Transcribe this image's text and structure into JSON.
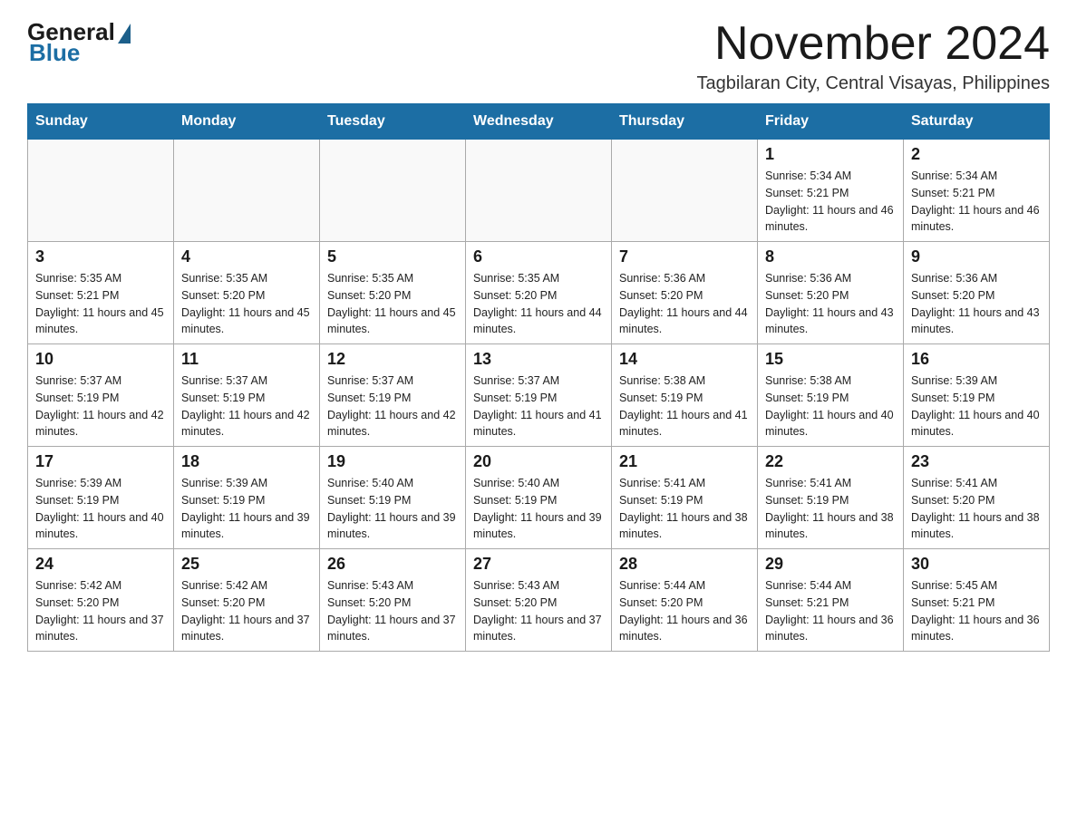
{
  "logo": {
    "general": "General",
    "blue": "Blue"
  },
  "title": "November 2024",
  "location": "Tagbilaran City, Central Visayas, Philippines",
  "days_of_week": [
    "Sunday",
    "Monday",
    "Tuesday",
    "Wednesday",
    "Thursday",
    "Friday",
    "Saturday"
  ],
  "weeks": [
    [
      {
        "day": "",
        "info": ""
      },
      {
        "day": "",
        "info": ""
      },
      {
        "day": "",
        "info": ""
      },
      {
        "day": "",
        "info": ""
      },
      {
        "day": "",
        "info": ""
      },
      {
        "day": "1",
        "info": "Sunrise: 5:34 AM\nSunset: 5:21 PM\nDaylight: 11 hours and 46 minutes."
      },
      {
        "day": "2",
        "info": "Sunrise: 5:34 AM\nSunset: 5:21 PM\nDaylight: 11 hours and 46 minutes."
      }
    ],
    [
      {
        "day": "3",
        "info": "Sunrise: 5:35 AM\nSunset: 5:21 PM\nDaylight: 11 hours and 45 minutes."
      },
      {
        "day": "4",
        "info": "Sunrise: 5:35 AM\nSunset: 5:20 PM\nDaylight: 11 hours and 45 minutes."
      },
      {
        "day": "5",
        "info": "Sunrise: 5:35 AM\nSunset: 5:20 PM\nDaylight: 11 hours and 45 minutes."
      },
      {
        "day": "6",
        "info": "Sunrise: 5:35 AM\nSunset: 5:20 PM\nDaylight: 11 hours and 44 minutes."
      },
      {
        "day": "7",
        "info": "Sunrise: 5:36 AM\nSunset: 5:20 PM\nDaylight: 11 hours and 44 minutes."
      },
      {
        "day": "8",
        "info": "Sunrise: 5:36 AM\nSunset: 5:20 PM\nDaylight: 11 hours and 43 minutes."
      },
      {
        "day": "9",
        "info": "Sunrise: 5:36 AM\nSunset: 5:20 PM\nDaylight: 11 hours and 43 minutes."
      }
    ],
    [
      {
        "day": "10",
        "info": "Sunrise: 5:37 AM\nSunset: 5:19 PM\nDaylight: 11 hours and 42 minutes."
      },
      {
        "day": "11",
        "info": "Sunrise: 5:37 AM\nSunset: 5:19 PM\nDaylight: 11 hours and 42 minutes."
      },
      {
        "day": "12",
        "info": "Sunrise: 5:37 AM\nSunset: 5:19 PM\nDaylight: 11 hours and 42 minutes."
      },
      {
        "day": "13",
        "info": "Sunrise: 5:37 AM\nSunset: 5:19 PM\nDaylight: 11 hours and 41 minutes."
      },
      {
        "day": "14",
        "info": "Sunrise: 5:38 AM\nSunset: 5:19 PM\nDaylight: 11 hours and 41 minutes."
      },
      {
        "day": "15",
        "info": "Sunrise: 5:38 AM\nSunset: 5:19 PM\nDaylight: 11 hours and 40 minutes."
      },
      {
        "day": "16",
        "info": "Sunrise: 5:39 AM\nSunset: 5:19 PM\nDaylight: 11 hours and 40 minutes."
      }
    ],
    [
      {
        "day": "17",
        "info": "Sunrise: 5:39 AM\nSunset: 5:19 PM\nDaylight: 11 hours and 40 minutes."
      },
      {
        "day": "18",
        "info": "Sunrise: 5:39 AM\nSunset: 5:19 PM\nDaylight: 11 hours and 39 minutes."
      },
      {
        "day": "19",
        "info": "Sunrise: 5:40 AM\nSunset: 5:19 PM\nDaylight: 11 hours and 39 minutes."
      },
      {
        "day": "20",
        "info": "Sunrise: 5:40 AM\nSunset: 5:19 PM\nDaylight: 11 hours and 39 minutes."
      },
      {
        "day": "21",
        "info": "Sunrise: 5:41 AM\nSunset: 5:19 PM\nDaylight: 11 hours and 38 minutes."
      },
      {
        "day": "22",
        "info": "Sunrise: 5:41 AM\nSunset: 5:19 PM\nDaylight: 11 hours and 38 minutes."
      },
      {
        "day": "23",
        "info": "Sunrise: 5:41 AM\nSunset: 5:20 PM\nDaylight: 11 hours and 38 minutes."
      }
    ],
    [
      {
        "day": "24",
        "info": "Sunrise: 5:42 AM\nSunset: 5:20 PM\nDaylight: 11 hours and 37 minutes."
      },
      {
        "day": "25",
        "info": "Sunrise: 5:42 AM\nSunset: 5:20 PM\nDaylight: 11 hours and 37 minutes."
      },
      {
        "day": "26",
        "info": "Sunrise: 5:43 AM\nSunset: 5:20 PM\nDaylight: 11 hours and 37 minutes."
      },
      {
        "day": "27",
        "info": "Sunrise: 5:43 AM\nSunset: 5:20 PM\nDaylight: 11 hours and 37 minutes."
      },
      {
        "day": "28",
        "info": "Sunrise: 5:44 AM\nSunset: 5:20 PM\nDaylight: 11 hours and 36 minutes."
      },
      {
        "day": "29",
        "info": "Sunrise: 5:44 AM\nSunset: 5:21 PM\nDaylight: 11 hours and 36 minutes."
      },
      {
        "day": "30",
        "info": "Sunrise: 5:45 AM\nSunset: 5:21 PM\nDaylight: 11 hours and 36 minutes."
      }
    ]
  ]
}
